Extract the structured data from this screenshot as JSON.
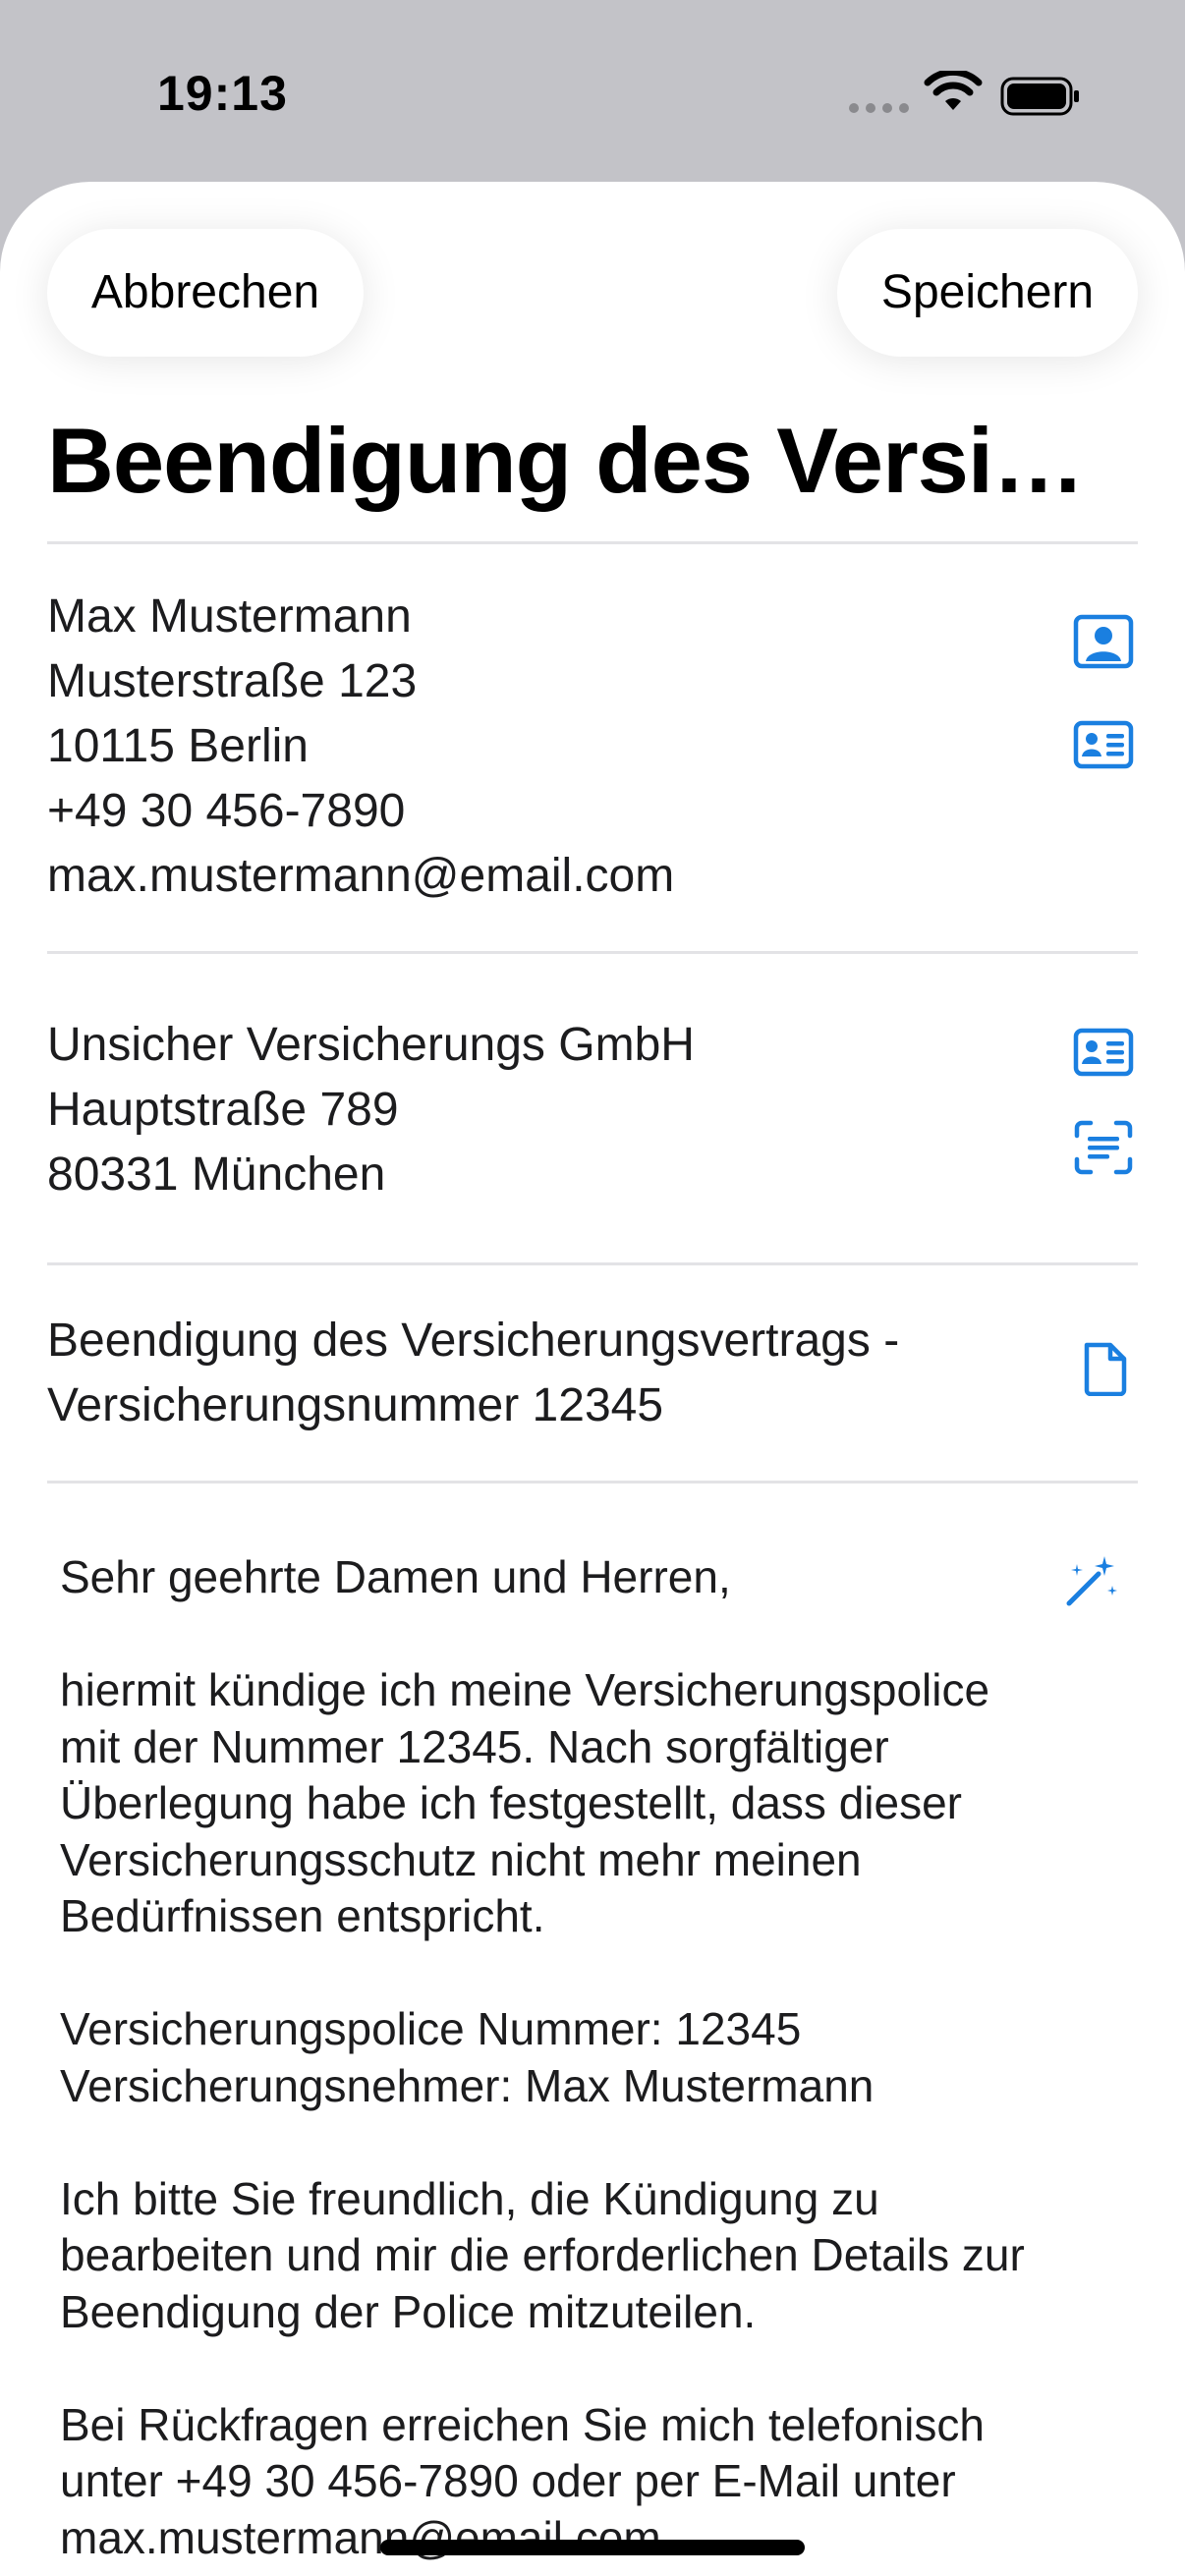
{
  "status": {
    "time": "19:13"
  },
  "toolbar": {
    "cancel_label": "Abbrechen",
    "save_label": "Speichern"
  },
  "title": "Beendigung des Versi…",
  "sender": {
    "name": "Max Mustermann",
    "street": "Musterstraße 123",
    "city": "10115 Berlin",
    "phone": "+49 30 456-7890",
    "email": "max.mustermann@email.com"
  },
  "recipient": {
    "company": "Unsicher Versicherungs GmbH",
    "street": "Hauptstraße 789",
    "city": "80331 München"
  },
  "subject": {
    "line1": "Beendigung des Versicherungsvertrags -",
    "line2": "Versicherungsnummer 12345"
  },
  "letter": {
    "greeting": "Sehr geehrte Damen und Herren,",
    "para1_lines": [
      "hiermit kündige ich meine Versicherungspolice",
      "mit der Nummer 12345. Nach sorgfältiger",
      "Überlegung habe ich festgestellt, dass dieser",
      "Versicherungsschutz nicht mehr meinen",
      "Bedürfnissen entspricht."
    ],
    "para2_lines": [
      "Versicherungspolice Nummer: 12345",
      "Versicherungsnehmer: Max Mustermann"
    ],
    "para3_lines": [
      "Ich bitte Sie freundlich, die Kündigung zu",
      "bearbeiten und mir die erforderlichen Details zur",
      "Beendigung der Police mitzuteilen."
    ],
    "para4_lines": [
      "Bei Rückfragen erreichen Sie mich telefonisch",
      "unter +49 30 456-7890 oder per E-Mail unter",
      "max.mustermann@email.com"
    ]
  },
  "icons": {
    "accent_color": "#1a7fe0",
    "person_picker": "person-square-icon",
    "contact_card": "contact-card-icon",
    "recipient_card": "contact-card-icon",
    "scan_text": "text-scan-icon",
    "document": "document-icon",
    "magic_wand": "magic-wand-icon"
  }
}
